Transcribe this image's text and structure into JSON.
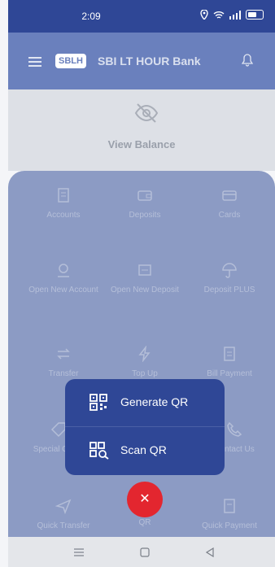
{
  "status_bar": {
    "time": "2:09",
    "icons": [
      "location-icon",
      "wifi-icon",
      "signal-icon",
      "battery-icon"
    ]
  },
  "header": {
    "logo_text": "SBLH",
    "title": "SBI LT HOUR Bank"
  },
  "balance": {
    "label": "View Balance"
  },
  "grid": {
    "row1": [
      "Accounts",
      "Deposits",
      "Cards"
    ],
    "row2": [
      "Open New Account",
      "Open New Deposit",
      "Deposit PLUS"
    ],
    "row3": [
      "Transfer",
      "Top Up",
      "Bill Payment"
    ],
    "row4_left": "Special Offers",
    "row4_right": "Contact Us"
  },
  "bottom_bar": {
    "left": "Quick Transfer",
    "center": "QR",
    "right": "Quick Payment"
  },
  "qr_popup": {
    "generate": "Generate QR",
    "scan": "Scan QR"
  },
  "fab": {
    "symbol": "✕"
  },
  "colors": {
    "primary": "#2f4796",
    "fab": "#e3262f"
  }
}
